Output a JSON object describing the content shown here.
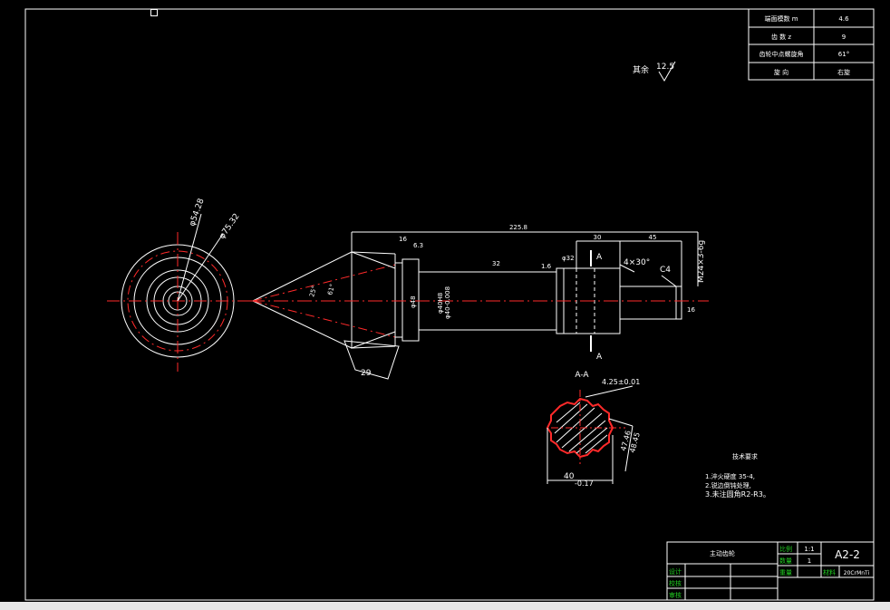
{
  "colors": {
    "background": "#000000",
    "line": "#ffffff",
    "center": "#ff2a2a",
    "table_border": "#ffffff",
    "title_green": "#22cc22"
  },
  "params_table": {
    "rows": [
      {
        "label": "端面模数 m",
        "value": "4.6"
      },
      {
        "label": "齿 数 z",
        "value": "9"
      },
      {
        "label": "齿轮中点螺旋角",
        "value": "61°"
      },
      {
        "label": "旋 向",
        "value": "右旋"
      }
    ]
  },
  "roughness_rest": {
    "label": "其余",
    "value": "12.5"
  },
  "dimensions": {
    "overall_length": "225.8",
    "len_30": "30",
    "len_45": "45",
    "thread": "M24×3-6g",
    "chamfer_4x30": "4×30°",
    "c4": "C4",
    "dia_48": "φ48",
    "dia_40": "φ40",
    "dia_phi_values": [
      "φ40H8",
      "φ40-0.008"
    ],
    "dia_54": "φ54.28",
    "dia_75": "φ75.32",
    "angle_1": "25°",
    "angle_2": "61°",
    "face_29": "29",
    "ra_16a": "16",
    "ra_63": "6.3",
    "ra_32": "32",
    "ra_16b": "1.6",
    "ra_32b": "φ32",
    "ra_16c": "16"
  },
  "section": {
    "title": "A-A",
    "label_a": "A",
    "spline_note": "4.25±0.01",
    "d1": "47.46",
    "d2": "48.45",
    "width": "40",
    "width_tol": "-0.17"
  },
  "tech_requirements": {
    "title": "技术要求",
    "items": [
      "1.淬火硬度 35-4,",
      "2.锐边倒钝处理,",
      "3.未注圆角R2-R3。"
    ]
  },
  "title_block": {
    "part_name": "主动齿轮",
    "scale_label": "比例",
    "scale_value": "1:1",
    "qty_label": "数量",
    "qty_value": "1",
    "weight_label": "重量",
    "drawing_no": "A2-2",
    "material_label": "材料",
    "material_value": "20CrMnTi",
    "designer_label": "设计",
    "checker_label": "校核",
    "approver_label": "审核"
  }
}
